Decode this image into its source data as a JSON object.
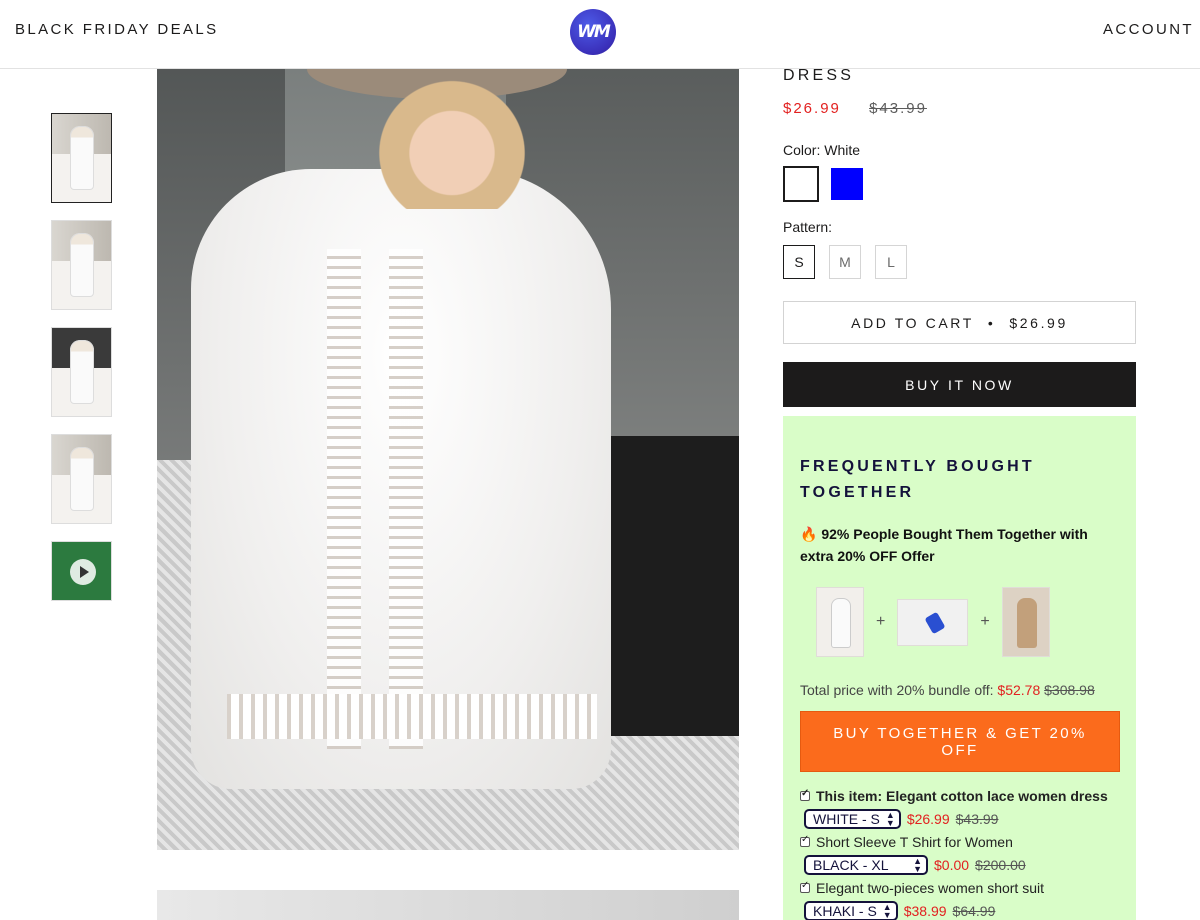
{
  "header": {
    "left_link": "BLACK FRIDAY DEALS",
    "logo_text": "WM",
    "right_link": "ACCOUNT"
  },
  "product": {
    "title": "DRESS",
    "price_new": "$26.99",
    "price_old": "$43.99",
    "color_label": "Color: White",
    "colors": [
      {
        "name": "White",
        "hex": "#ffffff"
      },
      {
        "name": "Blue",
        "hex": "#0000ff"
      }
    ],
    "pattern_label": "Pattern:",
    "sizes": [
      "S",
      "M",
      "L"
    ],
    "selected_size": "S",
    "add_to_cart_label": "ADD TO CART",
    "add_to_cart_separator": "•",
    "add_to_cart_price": "$26.99",
    "buy_now_label": "BUY IT NOW"
  },
  "bundle": {
    "title_line1": "FREQUENTLY BOUGHT",
    "title_line2": "TOGETHER",
    "promo_line1": "🔥 92% People Bought Them Together with",
    "promo_line2": "extra 20% OFF Offer",
    "plus": "+",
    "total_label": "Total price with 20% bundle off:",
    "total_new": "$52.78",
    "total_old": "$308.98",
    "button_label": "BUY TOGETHER & GET 20% OFF",
    "items": [
      {
        "name": "This item: Elegant cotton lace women dress",
        "variant": "WHITE - S",
        "price_new": "$26.99",
        "price_old": "$43.99"
      },
      {
        "name": "Short Sleeve T Shirt for Women",
        "variant": "BLACK - XL",
        "price_new": "$0.00",
        "price_old": "$200.00"
      },
      {
        "name": "Elegant two-pieces women short suit",
        "variant": "KHAKI - S",
        "price_new": "$38.99",
        "price_old": "$64.99"
      }
    ],
    "colors": {
      "background": "#d9fdc8",
      "button": "#fb6b1c",
      "sale": "#e22120",
      "title": "#14123b"
    }
  }
}
